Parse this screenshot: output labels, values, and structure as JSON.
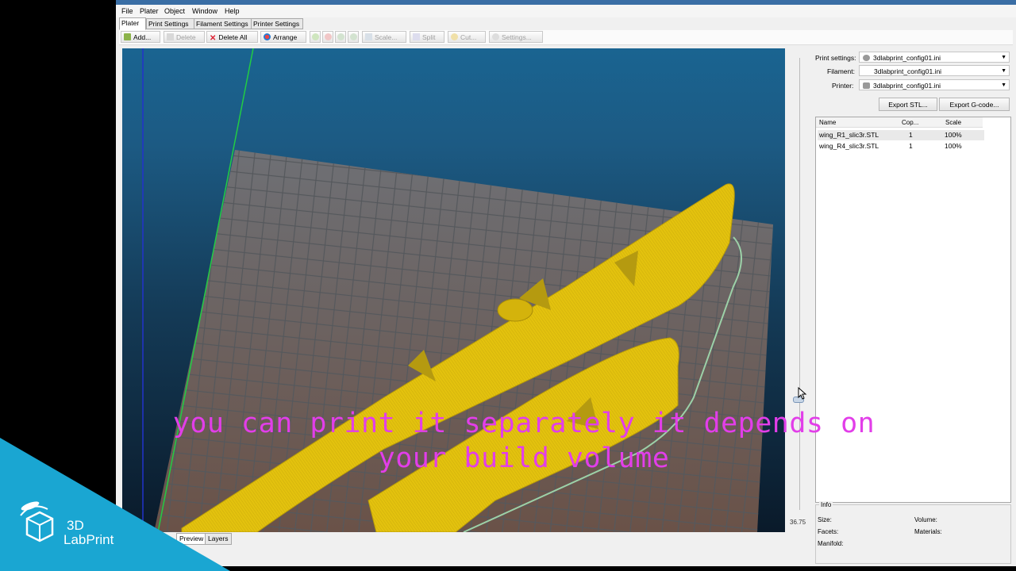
{
  "menu": [
    "File",
    "Plater",
    "Object",
    "Window",
    "Help"
  ],
  "tabs": [
    "Plater",
    "Print Settings",
    "Filament Settings",
    "Printer Settings"
  ],
  "toolbar": {
    "add": "Add...",
    "delete": "Delete",
    "delete_all": "Delete All",
    "arrange": "Arrange",
    "scale": "Scale...",
    "split": "Split",
    "cut": "Cut...",
    "settings": "Settings..."
  },
  "settings": {
    "print_label": "Print settings:",
    "print_value": "3dlabprint_config01.ini",
    "filament_label": "Filament:",
    "filament_value": "3dlabprint_config01.ini",
    "printer_label": "Printer:",
    "printer_value": "3dlabprint_config01.ini"
  },
  "export": {
    "stl": "Export STL...",
    "gcode": "Export G-code..."
  },
  "object_list": {
    "headers": [
      "Name",
      "Cop...",
      "Scale"
    ],
    "rows": [
      {
        "name": "wing_R1_slic3r.STL",
        "copies": "1",
        "scale": "100%"
      },
      {
        "name": "wing_R4_slic3r.STL",
        "copies": "1",
        "scale": "100%"
      }
    ]
  },
  "info": {
    "title": "Info",
    "size": "Size:",
    "volume": "Volume:",
    "facets": "Facets:",
    "materials": "Materials:",
    "manifold": "Manifold:"
  },
  "layer_value": "36.75",
  "view_tabs": [
    "Preview",
    "Layers"
  ],
  "caption": {
    "line1": "you can print it separately it depends on",
    "line2": "your build volume"
  },
  "logo": {
    "line1": "3D",
    "line2": "LabPrint"
  },
  "colors": {
    "caption": "#e23ee9",
    "model": "#e3c20e",
    "bed": "#6e7075",
    "logo_bg": "#1aa6d2"
  }
}
